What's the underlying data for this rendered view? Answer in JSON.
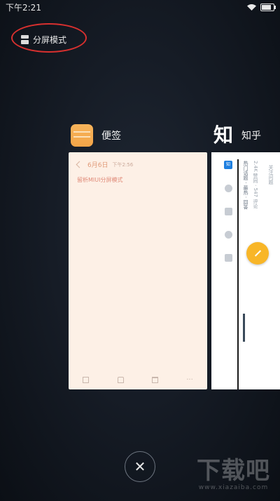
{
  "status_bar": {
    "time": "下午2:21",
    "wifi_icon": "wifi-icon",
    "battery_icon": "battery-icon"
  },
  "split_mode": {
    "label": "分屏模式",
    "icon": "split-screen-icon",
    "annotation_color": "#d8302f"
  },
  "cards": {
    "note": {
      "app_name": "便签",
      "icon": "notes-app-icon",
      "date": "6月6日",
      "time": "下午2:56",
      "text": "留析MIUI分屏模式",
      "toolbar": [
        "share-icon",
        "shirt-icon",
        "trash-icon",
        "more-icon"
      ],
      "more_label": "···",
      "bg_color": "#fdf0e6"
    },
    "zhihu": {
      "app_name": "知乎",
      "glyph": "知",
      "logo_text": "知",
      "col_a": "热门话题 · 最热 · 回答",
      "col_b": "2.4K 赞同 · 547 评论",
      "col_c": "关注问题",
      "fab_icon": "edit-icon",
      "fab_color": "#f8b628"
    }
  },
  "close_button": {
    "symbol": "✕",
    "icon": "close-icon"
  },
  "watermark": {
    "main": "下载吧",
    "sub": "www.xiazaiba.com"
  }
}
